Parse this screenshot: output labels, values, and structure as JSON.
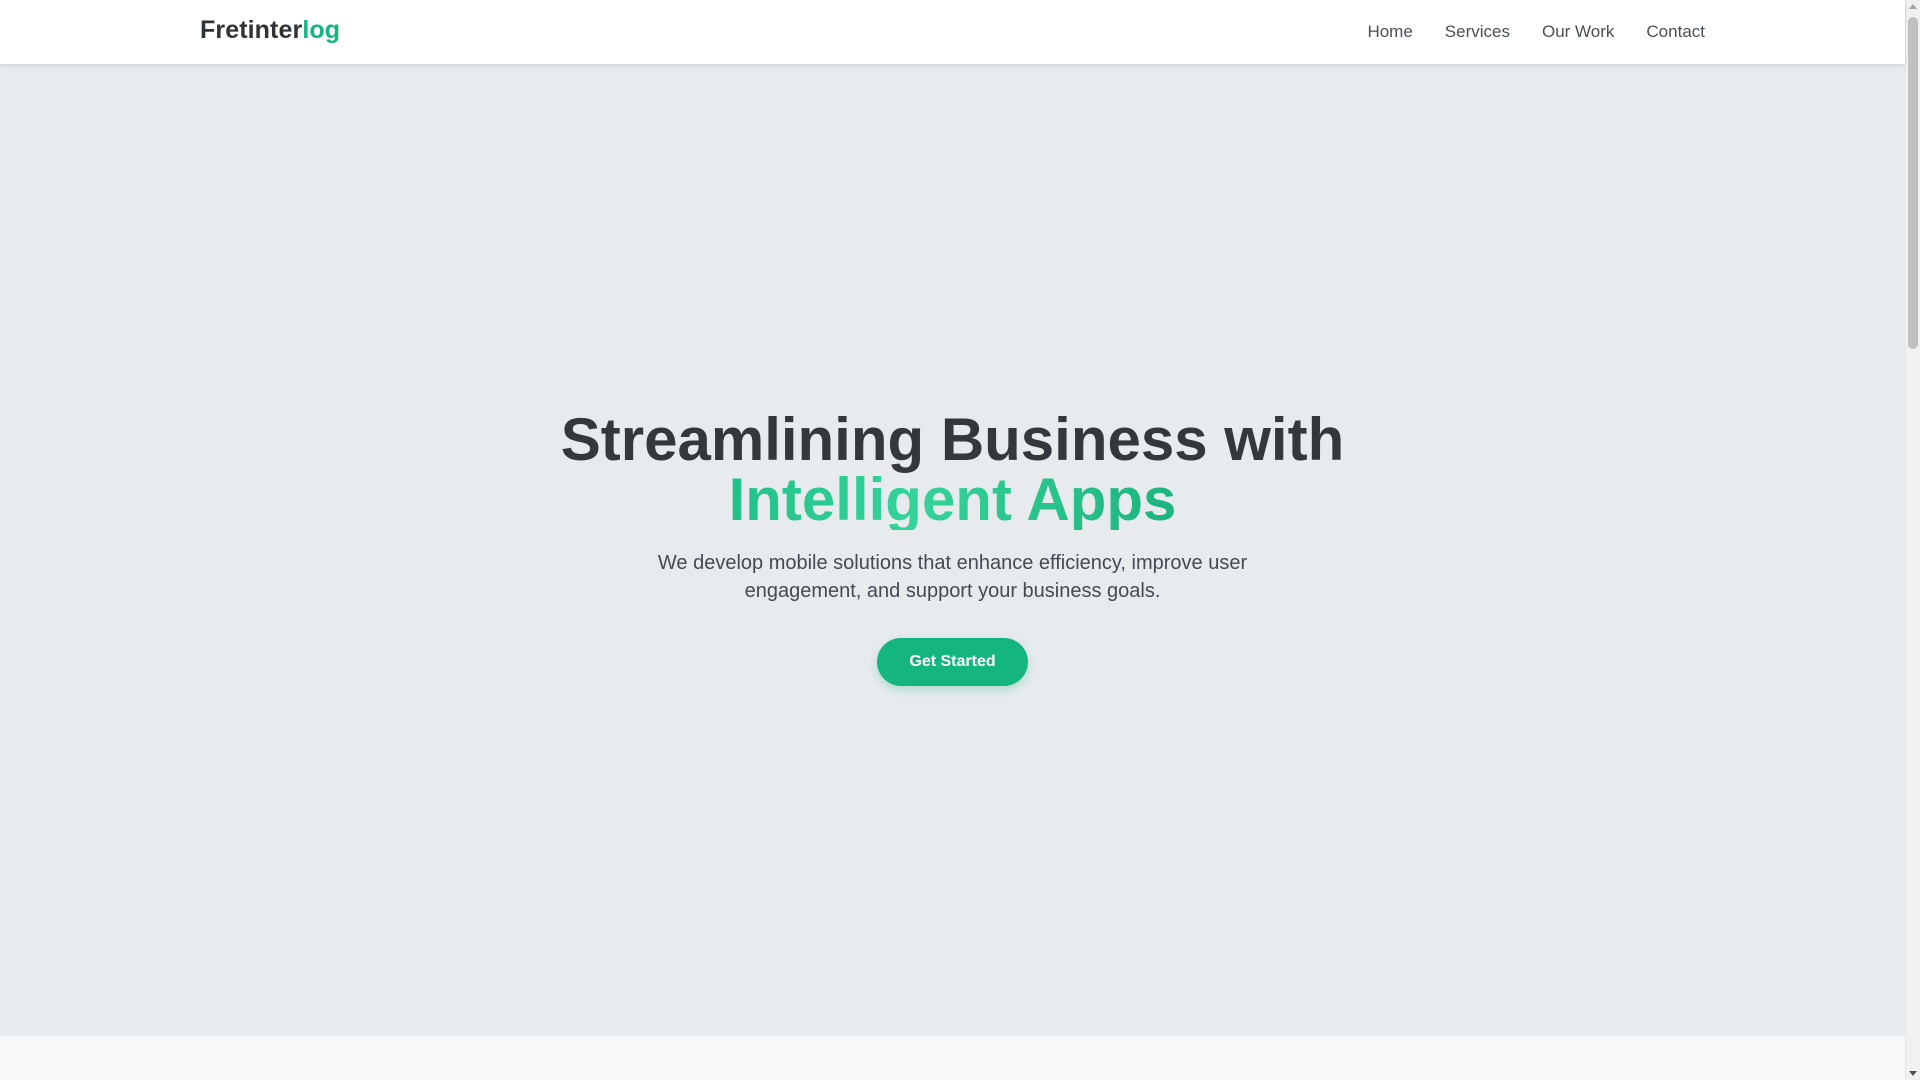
{
  "header": {
    "logo_main": "Fretinter",
    "logo_accent": "log",
    "nav": [
      {
        "label": "Home"
      },
      {
        "label": "Services"
      },
      {
        "label": "Our Work"
      },
      {
        "label": "Contact"
      }
    ]
  },
  "hero": {
    "title_line1": "Streamlining Business with",
    "title_line2": "Intelligent Apps",
    "subtitle": "We develop mobile solutions that enhance efficiency, improve user engagement, and support your business goals.",
    "cta_label": "Get Started"
  },
  "colors": {
    "accent": "#14b57f",
    "text_dark": "#34373c",
    "hero_background": "#e8ebee",
    "header_background": "#ffffff"
  },
  "icons": {
    "scroll_up": "scroll-up-arrow-icon",
    "scroll_down": "scroll-down-arrow-icon"
  }
}
